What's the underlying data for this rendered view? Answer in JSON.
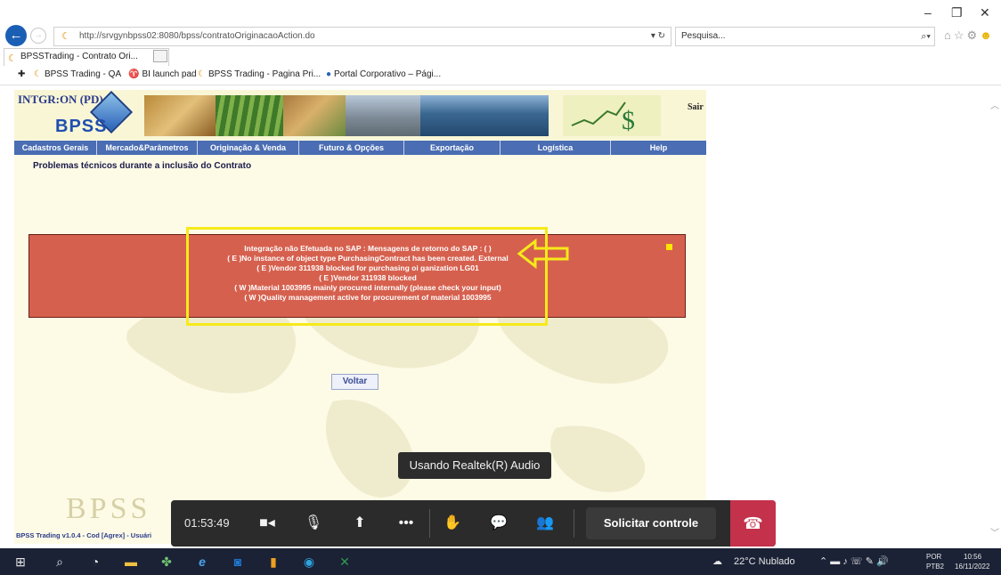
{
  "browser": {
    "url": "http://srvgynbpss02:8080/bpss/contratoOriginacaoAction.do",
    "search_placeholder": "Pesquisa...",
    "tab_title": "BPSSTrading - Contrato Ori...",
    "tab_close": "×",
    "win_min": "–",
    "win_max": "❐",
    "win_close": "✕",
    "favorites": [
      {
        "label": "BPSS Trading - QA",
        "icon": "bpss-icon"
      },
      {
        "label": "BI launch pad",
        "icon": "bi-icon"
      },
      {
        "label": "BPSS Trading - Pagina Pri...",
        "icon": "bpss-icon"
      },
      {
        "label": "Portal Corporativo – Pági...",
        "icon": "portal-icon"
      }
    ]
  },
  "app": {
    "title": "INTGR:ON (PD)",
    "logo_text": "BPSS",
    "logout": "Sair",
    "menu": [
      "Cadastros Gerais",
      "Mercado&Parâmetros",
      "Originação & Venda",
      "Futuro & Opções",
      "Exportação",
      "Logística",
      "Help"
    ],
    "problem_heading": "Problemas técnicos durante a inclusão do Contrato",
    "error_lines": [
      "Integração não Efetuada no SAP : Mensagens de retorno do SAP : ( )",
      "( E )No instance of object type PurchasingContract has been created. External",
      "( E )Vendor 311938 blocked for purchasing oi ganization LG01",
      "( E )Vendor 311938 blocked",
      "( W )Material 1003995 mainly procured internally (please check your input)",
      "( W )Quality management active for procurement of material 1003995"
    ],
    "back_button": "Voltar",
    "watermark": "BPSS",
    "footer": "BPSS Trading v1.0.4 - Cod [Agrex] - Usuári"
  },
  "teams": {
    "audio_device": "Usando Realtek(R) Audio",
    "timer": "01:53:49",
    "request_control": "Solicitar controle"
  },
  "taskbar": {
    "weather": "22°C Nublado",
    "lang_top": "POR",
    "lang_bottom": "PTB2",
    "time": "10:56",
    "date": "16/11/2022"
  },
  "colors": {
    "menu_bar": "#4a6db3",
    "error_box": "#d6604e",
    "highlight": "#f6ea1a",
    "hangup": "#c4314b",
    "taskbar": "#1b2236"
  }
}
